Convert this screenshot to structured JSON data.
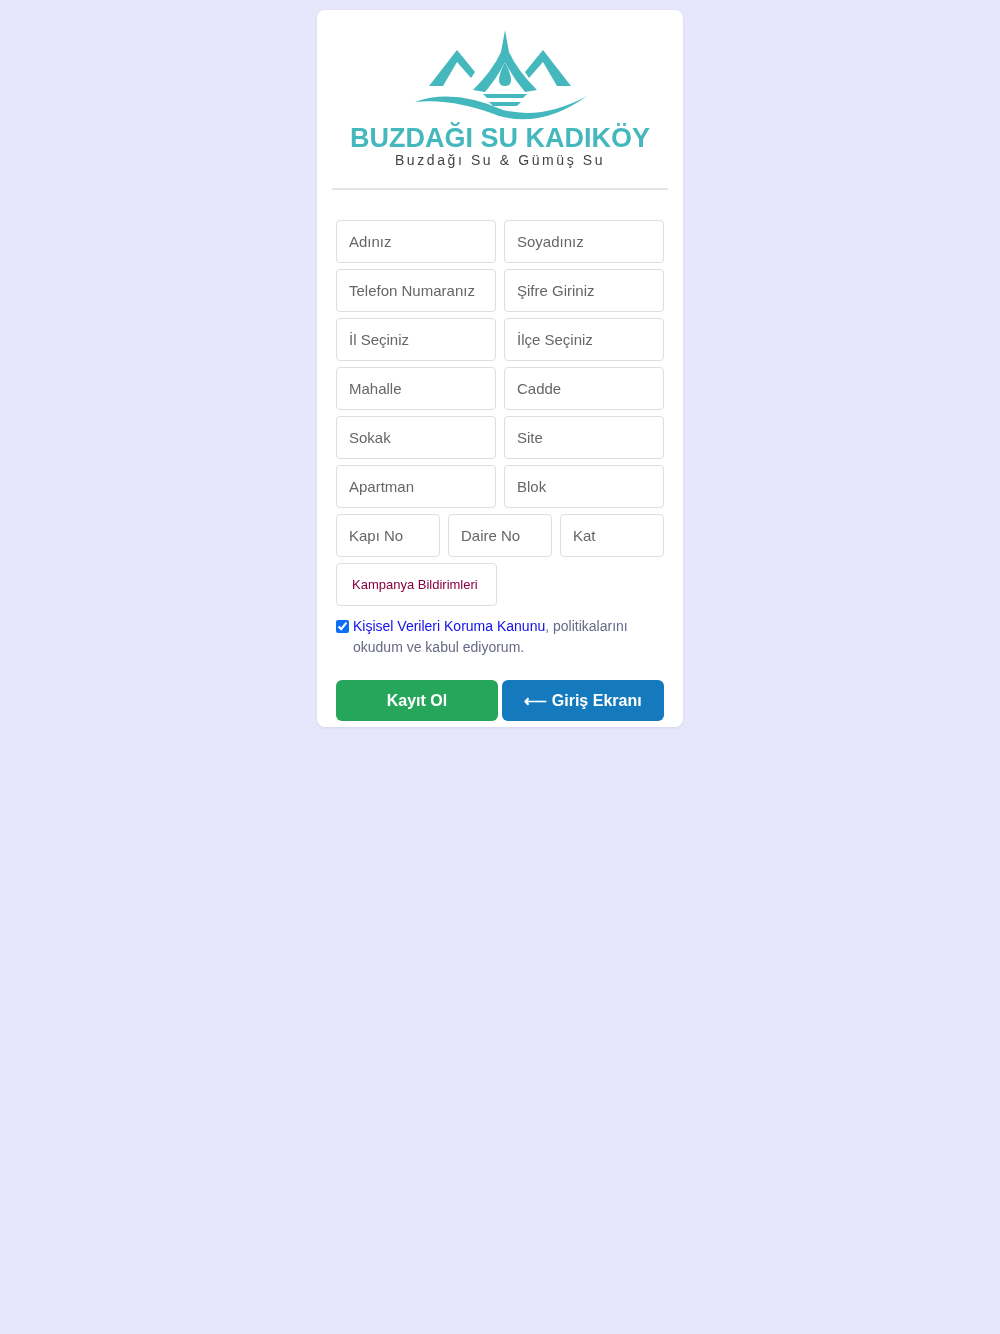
{
  "brand": {
    "title": "BUZDAĞI SU KADIKÖY",
    "subtitle": "Buzdağı Su & Gümüş Su"
  },
  "field_rows": [
    {
      "fields": [
        {
          "placeholder": "Adınız"
        },
        {
          "placeholder": "Soyadınız"
        }
      ]
    },
    {
      "fields": [
        {
          "placeholder": "Telefon Numaranız"
        },
        {
          "placeholder": "Şifre Giriniz"
        }
      ]
    },
    {
      "fields": [
        {
          "placeholder": "İl Seçiniz"
        },
        {
          "placeholder": "İlçe Seçiniz"
        }
      ]
    },
    {
      "fields": [
        {
          "placeholder": "Mahalle"
        },
        {
          "placeholder": "Cadde"
        }
      ]
    },
    {
      "fields": [
        {
          "placeholder": "Sokak"
        },
        {
          "placeholder": "Site"
        }
      ]
    },
    {
      "fields": [
        {
          "placeholder": "Apartman"
        },
        {
          "placeholder": "Blok"
        }
      ]
    },
    {
      "fields": [
        {
          "placeholder": "Kapı No"
        },
        {
          "placeholder": "Daire No"
        },
        {
          "placeholder": "Kat"
        }
      ]
    }
  ],
  "campaign": {
    "label": "Kampanya Bildirimleri"
  },
  "consent": {
    "checked": true,
    "link": "Kişisel Verileri Koruma Kanunu",
    "text": ", politikalarını okudum ve kabul ediyorum."
  },
  "buttons": [
    {
      "kind": "primary",
      "label": "Kayıt Ol"
    },
    {
      "kind": "secondary",
      "label": "⟵ Giriş Ekranı"
    }
  ]
}
